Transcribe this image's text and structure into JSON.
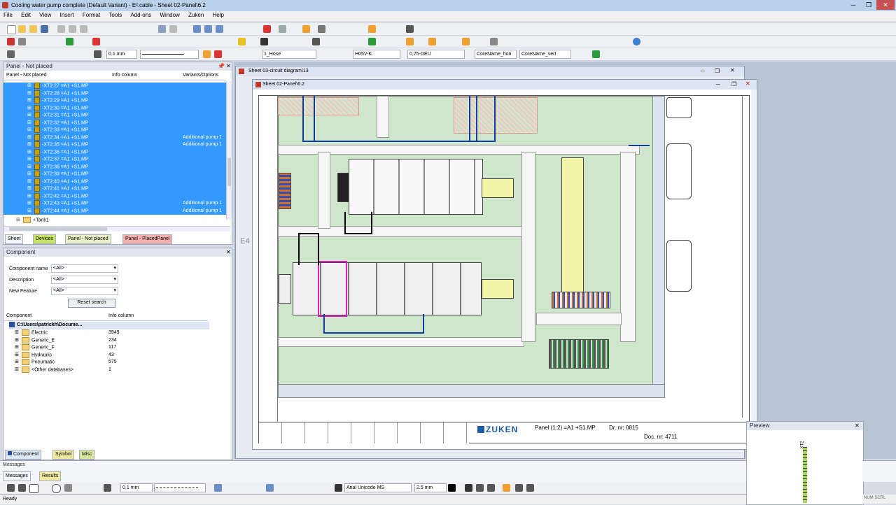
{
  "window": {
    "title": "Cooling water pump complete (Default Variant) - E³.cable - Sheet 02-Panel\\6.2"
  },
  "menu": [
    "File",
    "Edit",
    "View",
    "Insert",
    "Format",
    "Tools",
    "Add-ons",
    "Window",
    "Zuken",
    "Help"
  ],
  "toolbar3": {
    "zoom": "0.1 mm",
    "hose": "1_Hose",
    "wire_type": "H05V-K",
    "cross_section": "0,75-DEU",
    "core_hori": "CoreName_hori",
    "core_vert": "CoreName_vert"
  },
  "left_panel": {
    "title": "Panel - Not placed",
    "columns": [
      "Panel - Not placed",
      "Info column",
      "Variants/Options"
    ],
    "rows": [
      {
        "label": "-XT2:27 =A1 +S1.MP",
        "variant": ""
      },
      {
        "label": "-XT2:28 =A1 +S1.MP",
        "variant": ""
      },
      {
        "label": "-XT2:29 =A1 +S1.MP",
        "variant": ""
      },
      {
        "label": "-XT2:30 =A1 +S1.MP",
        "variant": ""
      },
      {
        "label": "-XT2:31 =A1 +S1.MP",
        "variant": ""
      },
      {
        "label": "-XT2:32 =A1 +S1.MP",
        "variant": ""
      },
      {
        "label": "-XT2:33 =A1 +S1.MP",
        "variant": ""
      },
      {
        "label": "-XT2:34 =A1 +S1.MP",
        "variant": "Additional pump 1"
      },
      {
        "label": "-XT2:35 =A1 +S1.MP",
        "variant": "Additional pump 1"
      },
      {
        "label": "-XT2:36 =A1 +S1.MP",
        "variant": ""
      },
      {
        "label": "-XT2:37 =A1 +S1.MP",
        "variant": ""
      },
      {
        "label": "-XT2:38 =A1 +S1.MP",
        "variant": ""
      },
      {
        "label": "-XT2:39 =A1 +S1.MP",
        "variant": ""
      },
      {
        "label": "-XT2:40 =A1 +S1.MP",
        "variant": ""
      },
      {
        "label": "-XT2:41 =A1 +S1.MP",
        "variant": ""
      },
      {
        "label": "-XT2:42 =A1 +S1.MP",
        "variant": ""
      },
      {
        "label": "-XT2:43 =A1 +S1.MP",
        "variant": "Additional pump 1"
      },
      {
        "label": "-XT2:44 =A1 +S1.MP",
        "variant": "Additional pump 1"
      }
    ],
    "tank_row": "+Tank1",
    "tabs": [
      "Sheet",
      "Devices",
      "Panel - Not placed",
      "Panel - PlacedPanel"
    ]
  },
  "component_panel": {
    "title": "Component",
    "fields": [
      {
        "label": "Component name",
        "value": "<All>"
      },
      {
        "label": "Description",
        "value": "<All>"
      },
      {
        "label": "New Feature",
        "value": "<All>"
      }
    ],
    "reset_label": "Reset search",
    "columns": [
      "Component",
      "Info column"
    ],
    "root": "C:\\Users\\patrickh\\Docume...",
    "items": [
      {
        "name": "Electric",
        "count": "3949"
      },
      {
        "name": "Generic_E",
        "count": "234"
      },
      {
        "name": "Generic_F",
        "count": "117"
      },
      {
        "name": "Hydraulic",
        "count": "43"
      },
      {
        "name": "Pneumatic",
        "count": "575"
      },
      {
        "name": "<Other databases>",
        "count": "1"
      }
    ],
    "tabs": [
      "Component",
      "Symbol",
      "Misc"
    ]
  },
  "windows": {
    "circuit": "Sheet 03-circuit diagram\\13",
    "panel": "Sheet 02-Panel\\6.2"
  },
  "drawing": {
    "brand": "ZUKEN",
    "panel_label": "Panel (1:2) =A1 +S1.MP",
    "drw_nr": "Dr. nr: 0815",
    "doc_nr": "Doc. nr: 4711",
    "side_label": "E4"
  },
  "preview": {
    "title": "Preview",
    "label": "XT2"
  },
  "messages": {
    "title": "Messages",
    "tabs": [
      "Messages",
      "Results"
    ]
  },
  "bottom_toolbar": {
    "line_width": "0.1 mm",
    "font": "Arial Unicode MS",
    "font_size": "2.5 mm"
  },
  "status": {
    "text": "Ready",
    "right": "NUM  SCRL"
  }
}
